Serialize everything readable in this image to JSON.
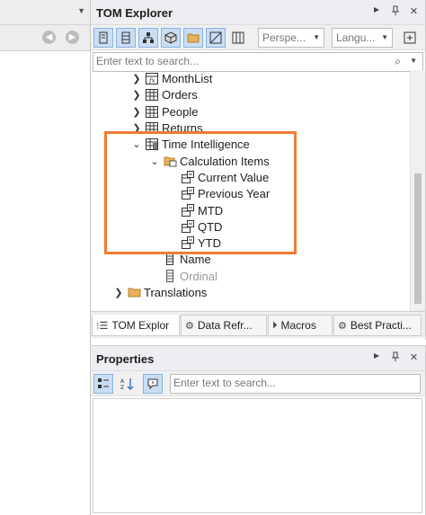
{
  "left": {
    "dropdown_icon": "chevron-down-icon",
    "back_icon": "back-arrow-icon",
    "forward_icon": "forward-arrow-icon"
  },
  "tom": {
    "title": "TOM Explorer",
    "toolbar": {
      "perspective_placeholder": "Perspe...",
      "language_placeholder": "Langu..."
    },
    "search_placeholder": "Enter text to search...",
    "tree": [
      {
        "label": "MonthList",
        "icon": "fx-table-icon",
        "expander": "collapsed"
      },
      {
        "label": "Orders",
        "icon": "table-icon",
        "expander": "collapsed"
      },
      {
        "label": "People",
        "icon": "table-icon",
        "expander": "collapsed"
      },
      {
        "label": "Returns",
        "icon": "table-icon",
        "expander": "collapsed"
      },
      {
        "label": "Time Intelligence",
        "icon": "calculation-group-icon",
        "expander": "expanded"
      },
      {
        "label": "Calculation Items",
        "icon": "folder-icon",
        "expander": "expanded"
      },
      {
        "label": "Current Value",
        "icon": "calculation-item-icon"
      },
      {
        "label": "Previous Year",
        "icon": "calculation-item-icon"
      },
      {
        "label": "MTD",
        "icon": "calculation-item-icon"
      },
      {
        "label": "QTD",
        "icon": "calculation-item-icon"
      },
      {
        "label": "YTD",
        "icon": "calculation-item-icon"
      },
      {
        "label": "Name",
        "icon": "column-icon"
      },
      {
        "label": "Ordinal",
        "icon": "column-icon",
        "hidden": true
      },
      {
        "label": "Translations",
        "icon": "folder-icon",
        "expander": "collapsed"
      }
    ],
    "tabs": [
      {
        "label": "TOM Explor",
        "icon": "tom-icon"
      },
      {
        "label": "Data Refr...",
        "icon": "gear-icon"
      },
      {
        "label": "Macros",
        "icon": "macro-icon"
      },
      {
        "label": "Best Practi...",
        "icon": "best-practice-icon"
      }
    ]
  },
  "properties": {
    "title": "Properties",
    "search_placeholder": "Enter text to search..."
  },
  "colors": {
    "highlight": "#ed7d31",
    "active_toolbar": "#c9def5",
    "accent": "#3b78c6"
  }
}
